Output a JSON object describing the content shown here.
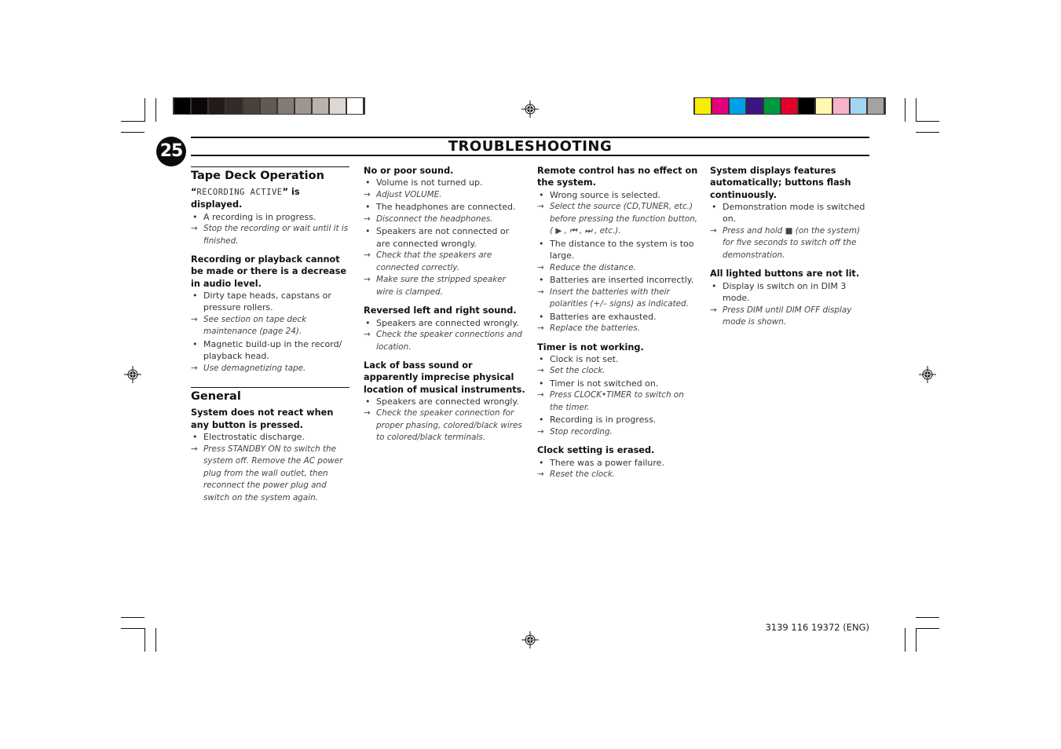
{
  "page": {
    "number": "25",
    "title": "TROUBLESHOOTING",
    "footer_code": "3139 116 19372 (ENG)"
  },
  "print_marks": {
    "gray_strip": [
      "#000000",
      "#0a0706",
      "#221b18",
      "#342a27",
      "#4a403c",
      "#625854",
      "#857a76",
      "#a0948f",
      "#bcb2ad",
      "#ddd8d4",
      "#ffffff"
    ],
    "color_strip": [
      "#f7ef00",
      "#e5007d",
      "#00a0e6",
      "#3c1581",
      "#009a3e",
      "#e3002a",
      "#000000",
      "#fff8ae",
      "#f6b3c9",
      "#a3d6f5",
      "#a3a3a3"
    ]
  },
  "columns": [
    {
      "blocks": [
        {
          "section": "Tape Deck Operation",
          "question_prefix": "“",
          "question_lcd": "RECORDING ACTIVE",
          "question_suffix": "” is displayed.",
          "items": [
            {
              "type": "cause",
              "text": "A recording is in progress."
            },
            {
              "type": "remedy",
              "text": "Stop the recording or wait until it is finished."
            }
          ]
        },
        {
          "question": "Recording or playback cannot be made or there is a decrease in audio level.",
          "items": [
            {
              "type": "cause",
              "text": "Dirty tape heads, capstans or pressure rollers."
            },
            {
              "type": "remedy",
              "text": "See section on tape deck maintenance (page 24)."
            },
            {
              "type": "cause",
              "text": "Magnetic build-up in the record/ playback head."
            },
            {
              "type": "remedy",
              "text": "Use demagnetizing tape."
            }
          ]
        },
        {
          "section": "General",
          "question": "System does not react when any button is pressed.",
          "items": [
            {
              "type": "cause",
              "text": "Electrostatic discharge."
            },
            {
              "type": "remedy",
              "text": "Press STANDBY ON to switch the system off. Remove the AC power plug from the wall outlet, then reconnect the power plug and switch on the system again."
            }
          ]
        }
      ]
    },
    {
      "blocks": [
        {
          "question": "No or poor sound.",
          "items": [
            {
              "type": "cause",
              "text": "Volume is not turned up."
            },
            {
              "type": "remedy",
              "text": "Adjust VOLUME."
            },
            {
              "type": "cause",
              "text": "The headphones are connected."
            },
            {
              "type": "remedy",
              "text": "Disconnect the headphones."
            },
            {
              "type": "cause",
              "text": "Speakers are not connected or are connected wrongly."
            },
            {
              "type": "remedy",
              "text": "Check that the speakers are connected correctly."
            },
            {
              "type": "remedy",
              "text": "Make sure the stripped speaker wire is clamped."
            }
          ]
        },
        {
          "question": "Reversed left and right sound.",
          "items": [
            {
              "type": "cause",
              "text": "Speakers are connected wrongly."
            },
            {
              "type": "remedy",
              "text": "Check the speaker connections and location."
            }
          ]
        },
        {
          "question": "Lack of bass sound or apparently imprecise physical location of musical instruments.",
          "items": [
            {
              "type": "cause",
              "text": "Speakers are connected wrongly."
            },
            {
              "type": "remedy",
              "text": "Check the speaker connection for proper phasing, colored/black wires to colored/black terminals."
            }
          ]
        }
      ]
    },
    {
      "blocks": [
        {
          "question": "Remote control has no effect on the system.",
          "items": [
            {
              "type": "cause",
              "text": "Wrong source is selected."
            },
            {
              "type": "remedy",
              "text": "Select the source (CD,TUNER, etc.) before pressing the function button, ( ▶ , ⏮ , ⏭ , etc.)."
            },
            {
              "type": "cause",
              "text": "The distance to the system is too large."
            },
            {
              "type": "remedy",
              "text": "Reduce the distance."
            },
            {
              "type": "cause",
              "text": "Batteries are inserted incorrectly."
            },
            {
              "type": "remedy",
              "text": "Insert the batteries with their polarities (+/– signs) as indicated."
            },
            {
              "type": "cause",
              "text": "Batteries are exhausted."
            },
            {
              "type": "remedy",
              "text": "Replace the batteries."
            }
          ]
        },
        {
          "question": "Timer is not working.",
          "items": [
            {
              "type": "cause",
              "text": "Clock is not set."
            },
            {
              "type": "remedy",
              "text": "Set the clock."
            },
            {
              "type": "cause",
              "text": "Timer is not switched on."
            },
            {
              "type": "remedy",
              "text": "Press CLOCK•TIMER to switch on the timer."
            },
            {
              "type": "cause",
              "text": "Recording is in progress."
            },
            {
              "type": "remedy",
              "text": "Stop recording."
            }
          ]
        },
        {
          "question": "Clock setting is erased.",
          "items": [
            {
              "type": "cause",
              "text": "There was a power failure."
            },
            {
              "type": "remedy",
              "text": "Reset the clock."
            }
          ]
        }
      ]
    },
    {
      "blocks": [
        {
          "question": "System displays features automatically; buttons flash continuously.",
          "items": [
            {
              "type": "cause",
              "text": "Demonstration mode is switched on."
            },
            {
              "type": "remedy",
              "text": "Press and hold ■ (on the system) for five seconds to switch off the demonstration."
            }
          ]
        },
        {
          "question": "All lighted buttons are not lit.",
          "items": [
            {
              "type": "cause",
              "text": "Display is switch on in DIM 3 mode."
            },
            {
              "type": "remedy",
              "text": "Press DIM until DIM OFF display mode is shown."
            }
          ]
        }
      ]
    }
  ],
  "markers": {
    "cause": "•",
    "remedy": "→"
  }
}
